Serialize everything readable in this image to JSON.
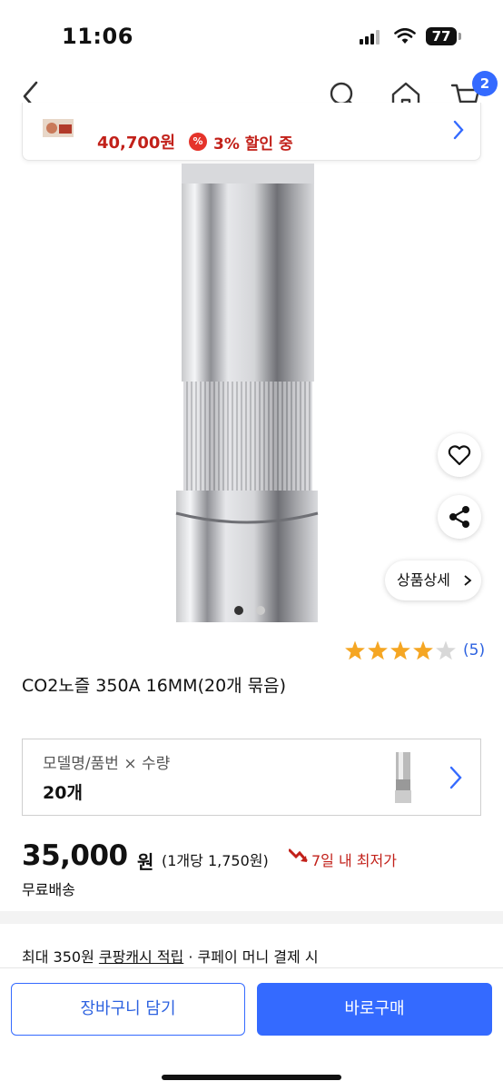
{
  "status_bar": {
    "time": "11:06",
    "battery": "77"
  },
  "nav": {
    "cart_count": "2"
  },
  "promo": {
    "price": "40,700원",
    "percent_symbol": "%",
    "discount": "3% 할인 중"
  },
  "product": {
    "image_count": 2,
    "active_image": 1,
    "detail_button": "상품상세",
    "rating": 4,
    "rating_max": 5,
    "review_count": "(5)",
    "title": "CO2노즐 350A 16MM(20개 묶음)"
  },
  "option": {
    "label": "모델명/품번 × 수량",
    "value": "20개"
  },
  "pricing": {
    "price": "35,000",
    "price_unit": "원",
    "unit_price": "(1개당 1,750원)",
    "lowest_badge": "7일 내 최저가",
    "shipping": "무료배송"
  },
  "cash": {
    "prefix": "최대 350원 ",
    "link": "쿠팡캐시 적립",
    "suffix": " · 쿠페이 머니 결제 시"
  },
  "actions": {
    "cart_label": "장바구니 담기",
    "buy_label": "바로구매"
  },
  "colors": {
    "accent": "#346aff",
    "sale_red": "#c2211a",
    "star": "#f5a623"
  }
}
